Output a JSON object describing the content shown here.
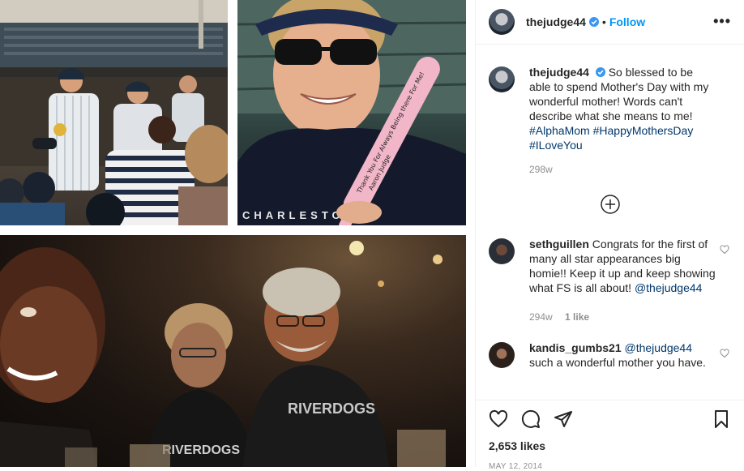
{
  "post": {
    "username": "thejudge44",
    "follow_label": "Follow",
    "separator": "•",
    "more_label": "•••",
    "caption": {
      "username": "thejudge44",
      "text": "So blessed to be able to spend Mother's Day with my wonderful mother! Words can't describe what she means to me!",
      "hashtags": [
        "#AlphaMom",
        "#HappyMothersDay",
        "#ILoveYou"
      ],
      "age": "298w"
    },
    "comments": [
      {
        "username": "sethguillen",
        "text": "Congrats for the first of many all star appearances big homie!! Keep it up and keep showing what FS is all about!",
        "mention": "@thejudge44",
        "age": "294w",
        "likes": "1 like"
      },
      {
        "username": "kandis_gumbs21",
        "mention": "@thejudge44",
        "text": "such a wonderful mother you have."
      }
    ],
    "likes_count": "2,653 likes",
    "date": "MAY 12, 2014",
    "photo_text": {
      "shirt_top": "CHARLESTON",
      "shirt_bottom": "RIVERDOGS",
      "bat_signature": "Thank You For Always Being there For Me!",
      "bat_name": "Aaron Judge",
      "shirt_3a": "RIVERDOGS",
      "shirt_3b": "RIVERDOGS"
    },
    "colors": {
      "accent": "#0095f6",
      "verified": "#3897f0",
      "link": "#00376b"
    }
  }
}
